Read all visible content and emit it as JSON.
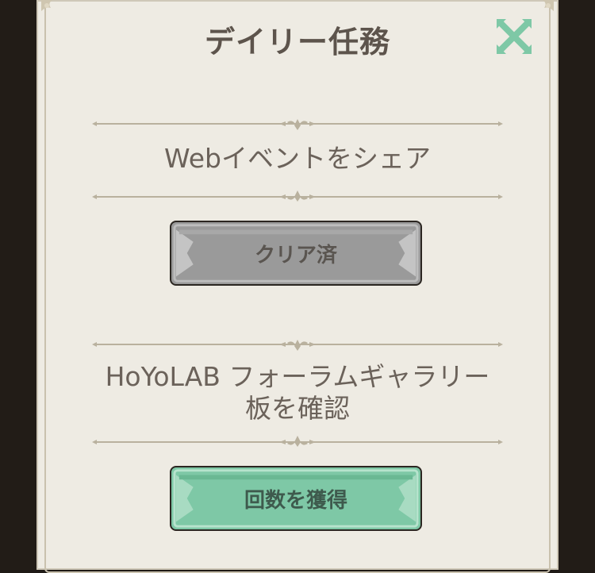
{
  "dialog": {
    "title": "デイリー任務",
    "close_icon": "close-x-icon"
  },
  "tasks": [
    {
      "text": "Webイベントをシェア",
      "button_label": "クリア済",
      "status": "completed"
    },
    {
      "text_line1": "HoYoLAB フォーラムギャラリー",
      "text_line2": "板を確認",
      "button_label": "回数を獲得",
      "status": "claimable"
    }
  ],
  "colors": {
    "panel": "#eeebe3",
    "title": "#5d544c",
    "close": "#7ec8a6",
    "button_done": "#9a9a9a",
    "button_claim": "#7ec8a6"
  }
}
